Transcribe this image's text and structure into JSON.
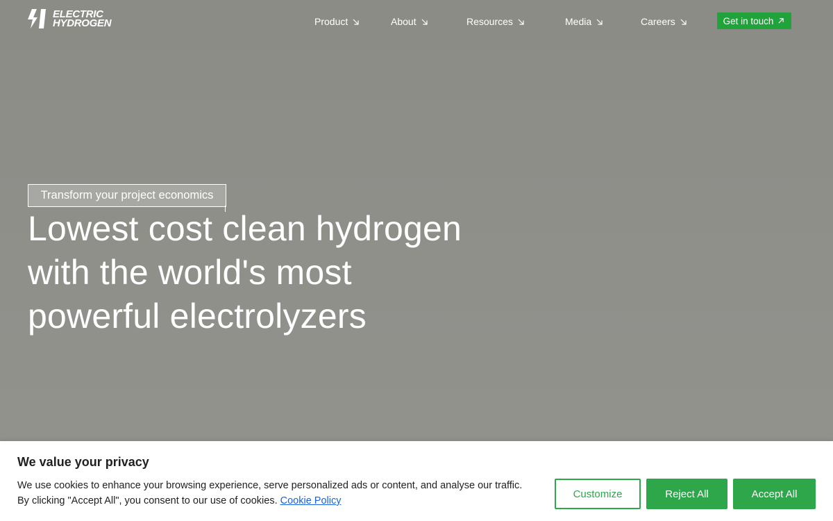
{
  "brand": {
    "logo_line1": "Electric",
    "logo_line2": "Hydrogen",
    "accent_color": "#1fa33a"
  },
  "nav": {
    "items": [
      {
        "label": "Product",
        "icon": "arrow-down-right-icon"
      },
      {
        "label": "About",
        "icon": "arrow-down-right-icon"
      },
      {
        "label": "Resources",
        "icon": "arrow-down-right-icon"
      },
      {
        "label": "Media",
        "icon": "arrow-down-right-icon"
      },
      {
        "label": "Careers",
        "icon": "arrow-down-right-icon"
      }
    ],
    "cta_label": "Get in touch",
    "cta_icon": "arrow-up-right-icon"
  },
  "hero": {
    "eyebrow": "Transform your project economics",
    "headline_line1": "Lowest cost clean hydrogen",
    "headline_line2": "with the world's most",
    "headline_line3": "powerful electrolyzers"
  },
  "cookie": {
    "title": "We value your privacy",
    "text": "We use cookies to enhance your browsing experience, serve personalized ads or content, and analyse our traffic. By clicking \"Accept All\", you consent to our use of cookies.",
    "link_label": "Cookie Policy",
    "customize_label": "Customize",
    "reject_label": "Reject All",
    "accept_label": "Accept All",
    "button_color": "#2ea64a"
  }
}
